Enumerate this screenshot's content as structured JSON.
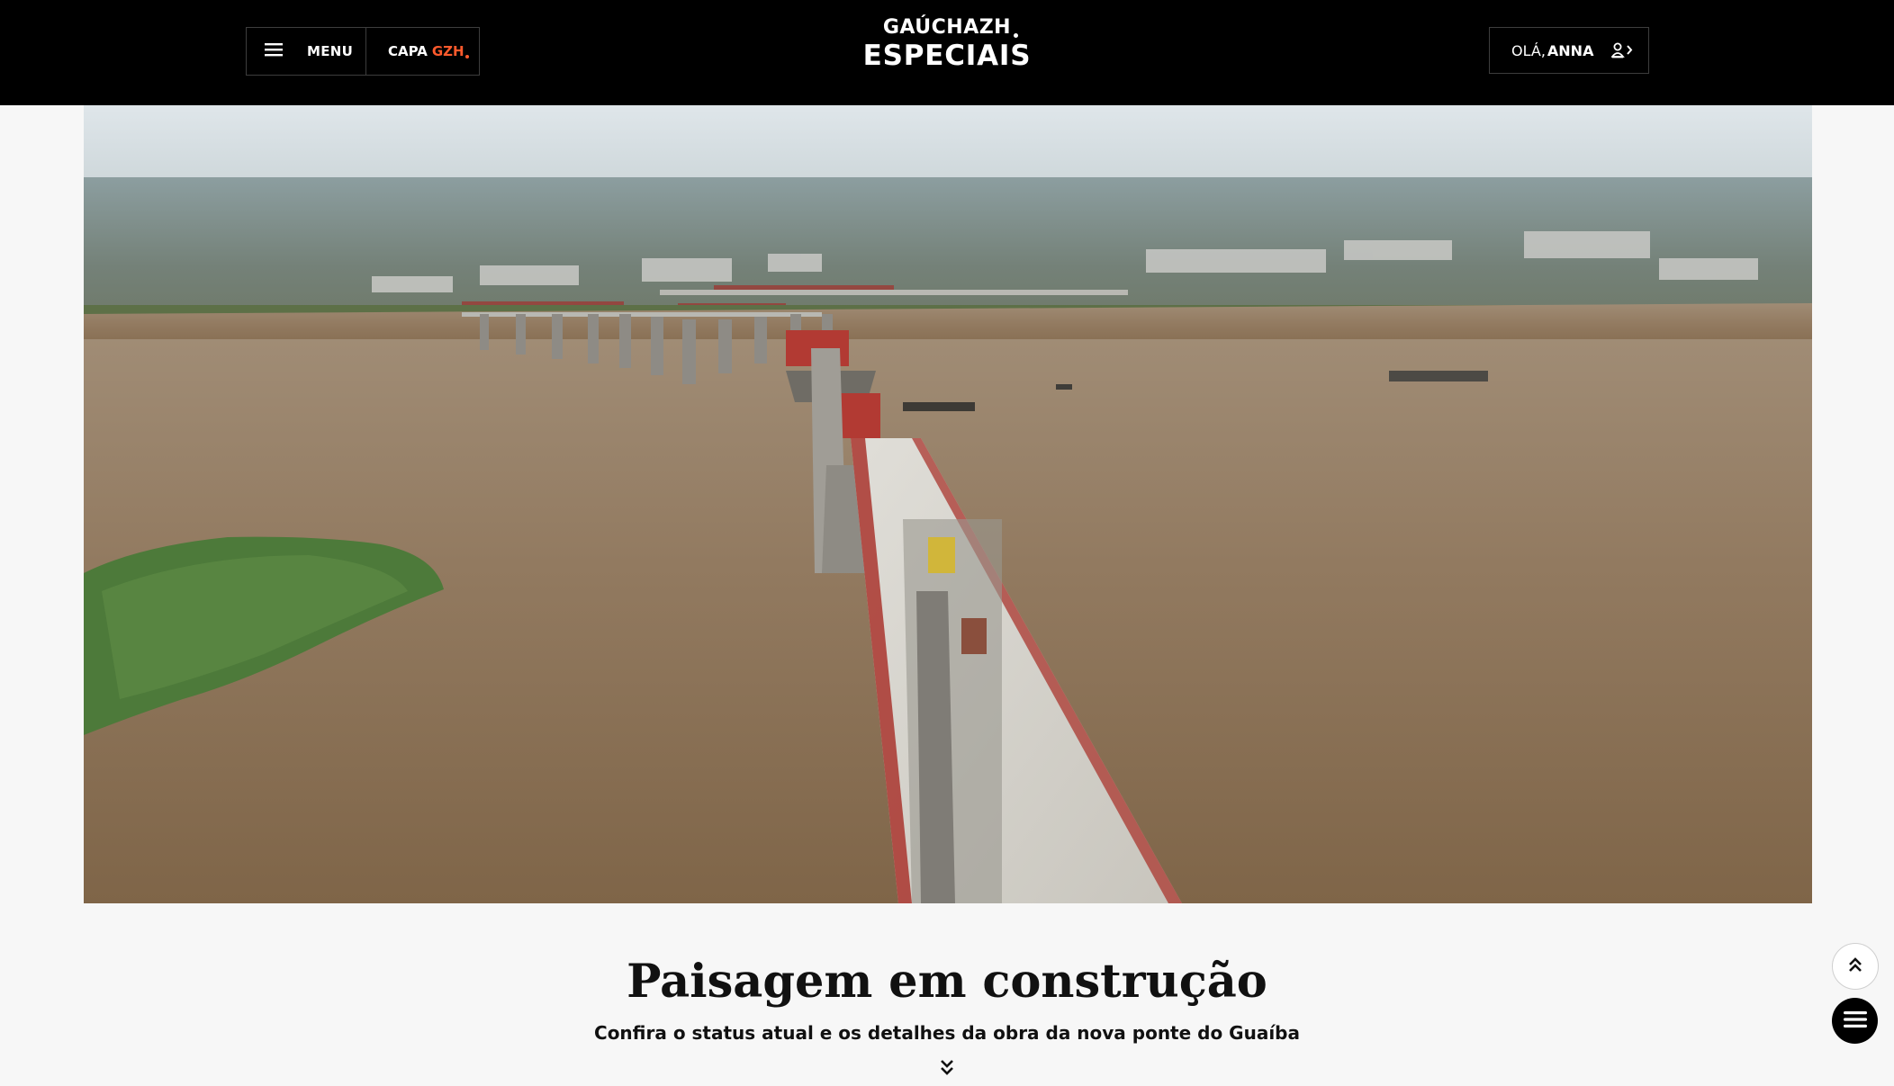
{
  "header": {
    "menu_label": "MENU",
    "capa_label": "CAPA",
    "capa_accent": "GZH",
    "logo_top": "GAÚCHAZH",
    "logo_bottom": "ESPECIAIS",
    "greeting": "OLÁ,",
    "user_name": "ANNA"
  },
  "hero": {
    "image_alt": "Vista aérea da obra da nova ponte do Guaíba"
  },
  "article": {
    "title": "Paisagem em construção",
    "subtitle": "Confira o status atual e os detalhes da obra da nova ponte do Guaíba"
  },
  "icons": {
    "menu": "hamburger-icon",
    "user": "user-icon",
    "scroll_down": "double-chevron-down-icon",
    "back_to_top": "double-chevron-up-icon",
    "floating_menu": "menu-icon"
  },
  "colors": {
    "header_bg": "#000000",
    "accent": "#ff5a2c",
    "page_bg": "#f7f7f7"
  }
}
